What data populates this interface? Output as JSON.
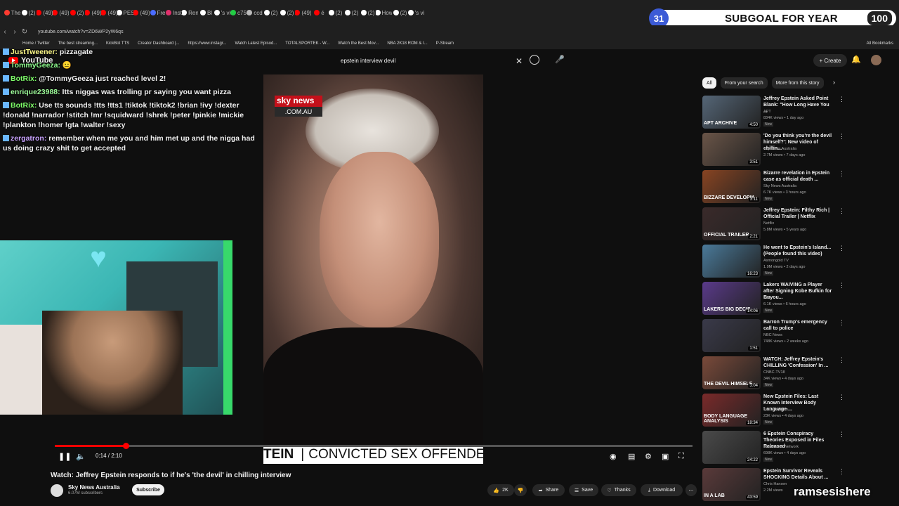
{
  "browser": {
    "tabs": [
      {
        "label": "The",
        "color": "#ff3b30"
      },
      {
        "label": "(2)",
        "color": "#ffffff"
      },
      {
        "label": "(49)",
        "color": "#ff0000"
      },
      {
        "label": "(49)",
        "color": "#ff0000"
      },
      {
        "label": "(2)",
        "color": "#ff0000"
      },
      {
        "label": "(49)",
        "color": "#ff0000"
      },
      {
        "label": "(49)",
        "color": "#ff0000"
      },
      {
        "label": "PES",
        "color": "#ffffff"
      },
      {
        "label": "(49)",
        "color": "#ff0000"
      },
      {
        "label": "Fre",
        "color": "#4a6cff"
      },
      {
        "label": "Inst",
        "color": "#e1306c"
      },
      {
        "label": "Ren",
        "color": "#ffffff"
      },
      {
        "label": "Bl",
        "color": "#ffffff"
      },
      {
        "label": "'s vi",
        "color": "#ffffff"
      },
      {
        "label": "c75",
        "color": "#22cc44"
      },
      {
        "label": "ccd",
        "color": "#bbbbbb"
      },
      {
        "label": "(2)",
        "color": "#ffffff"
      },
      {
        "label": "(2)",
        "color": "#ffffff"
      },
      {
        "label": "(49)",
        "color": "#ff0000"
      },
      {
        "label": "é",
        "color": "#ff0000"
      },
      {
        "label": "(2)",
        "color": "#ffffff"
      },
      {
        "label": "(2)",
        "color": "#ffffff"
      },
      {
        "label": "(2)",
        "color": "#ffffff"
      },
      {
        "label": "How",
        "color": "#ffffff"
      },
      {
        "label": "(2)",
        "color": "#ffffff"
      },
      {
        "label": "'s vi",
        "color": "#ffffff"
      }
    ],
    "url": "youtube.com/watch?v=ZD6WP2yW6qs",
    "bookmarks": [
      "Home / Twitter",
      "The best streaming...",
      "KickBot TTS",
      "Creator Dashboard |...",
      "https://www.instagr...",
      "Watch Latest Episod...",
      "TOTALSPORTEK - W...",
      "Watch the Best Mov...",
      "NBA 2K18 ROM & I...",
      "P-Stream"
    ],
    "all_bookmarks": "All Bookmarks"
  },
  "goal": {
    "number": "31",
    "text": "SUBGOAL FOR YEAR",
    "target": "100"
  },
  "youtube": {
    "logo": "YouTube",
    "search_value": "epstein interview devil",
    "create": "Create",
    "notif_count": "9+"
  },
  "chat": [
    {
      "user": "JustTweener:",
      "msg": "pizzagate",
      "cls": "u1"
    },
    {
      "user": "TommyGeeza:",
      "msg": "😐",
      "cls": "u2"
    },
    {
      "user": "BotRix:",
      "msg": "@TommyGeeza just reached level 2!",
      "cls": "u3"
    },
    {
      "user": "enrique23988:",
      "msg": "Itts niggas was trolling pr saying you want pizza",
      "cls": "u4"
    },
    {
      "user": "BotRix:",
      "msg": "Use tts sounds !tts !tts1 !tiktok !tiktok2 !brian !ivy !dexter !donald !narrador !stitch !mr !squidward !shrek !peter !pinkie !mickie !plankton !homer !gta !walter !sexy",
      "cls": "u5"
    },
    {
      "user": "zergatron:",
      "msg": "remember when me you and him met up and the nigga had us doing crazy shit to get accepted",
      "cls": "u6"
    }
  ],
  "video": {
    "sky_top": "sky news",
    "sky_bottom": ".COM.AU",
    "ticker_left": "TEIN",
    "ticker_sep": "|",
    "ticker_right": "CONVICTED SEX OFFENDER",
    "time": "0:14 / 2:10",
    "progress": 0.111,
    "title": "Watch: Jeffrey Epstein responds to if he's 'the devil' in chilling interview",
    "channel": "Sky News Australia",
    "subscribers": "6.07M subscribers",
    "subscribe": "Subscribe",
    "likes": "2K",
    "share": "Share",
    "save": "Save",
    "thanks": "Thanks",
    "download": "Download"
  },
  "chips": [
    "All",
    "From your search",
    "More from this story"
  ],
  "recs": [
    {
      "title": "Jeffrey Epstein Asked Point Blank: \"How Long Have You ...",
      "channel": "APT",
      "views": "834K views • 1 day ago",
      "badge": "New",
      "dur": "4:50",
      "cap": "APT ARCHIVE",
      "thumb": "#556677"
    },
    {
      "title": "'Do you think you're the devil himself?': New video of chillin...",
      "channel": "Sky News Australia",
      "views": "2.7M views • 7 days ago",
      "badge": "",
      "dur": "3:51",
      "cap": "",
      "thumb": "#6a5548"
    },
    {
      "title": "Bizarre revelation in Epstein case as official death ...",
      "channel": "Sky News Australia",
      "views": "6.7K views • 3 hours ago",
      "badge": "New",
      "dur": "3:11",
      "cap": "BIZZARE DEVELOPM",
      "thumb": "#884422"
    },
    {
      "title": "Jeffrey Epstein: Filthy Rich | Official Trailer | Netflix",
      "channel": "Netflix",
      "views": "5.8M views • 5 years ago",
      "badge": "",
      "dur": "2:21",
      "cap": "OFFICIAL TRAILER",
      "thumb": "#3a2a2a"
    },
    {
      "title": "He went to Epstein's Island... (People found this video)",
      "channel": "Asmongold TV",
      "views": "1.9M views • 2 days ago",
      "badge": "New",
      "dur": "16:23",
      "cap": "",
      "thumb": "#4a7a9a"
    },
    {
      "title": "Lakers WAIVING a Player after Signing Kobe Bufkin for Buyou...",
      "channel": "JSM",
      "views": "6.1K views • 6 hours ago",
      "badge": "New",
      "dur": "14:06",
      "cap": "LAKERS BIG DECIS",
      "thumb": "#5a3a8a"
    },
    {
      "title": "Barron Trump's emergency call to police",
      "channel": "NBC News",
      "views": "748K views • 2 weeks ago",
      "badge": "",
      "dur": "1:51",
      "cap": "",
      "thumb": "#3a3a4a"
    },
    {
      "title": "WATCH: Jeffrey Epstein's CHILLING 'Confession' In ...",
      "channel": "CNBC-TV18",
      "views": "34K views • 4 days ago",
      "badge": "New",
      "dur": "3:04",
      "cap": "THE DEVIL HIMSELF",
      "thumb": "#7a4a3a"
    },
    {
      "title": "New Epstein Files: Last Known Interview Body Language ...",
      "channel": "Dr. G Explains",
      "views": "23K views • 4 days ago",
      "badge": "New",
      "dur": "18:34",
      "cap": "BODY LANGUAGE ANALYSIS",
      "thumb": "#7a2a2a"
    },
    {
      "title": "6 Epstein Conspiracy Theories Exposed in Files Released",
      "channel": "Law&Crime Network",
      "views": "698K views • 4 days ago",
      "badge": "New",
      "dur": "24:22",
      "cap": "",
      "thumb": "#4a4a4a"
    },
    {
      "title": "Epstein Survivor Reveals SHOCKING Details About ...",
      "channel": "Chris Hansen",
      "views": "2.2M views",
      "badge": "",
      "dur": "43:59",
      "cap": "IN A LAB",
      "thumb": "#5a3a3a"
    }
  ],
  "watermark": "ramsesishere"
}
